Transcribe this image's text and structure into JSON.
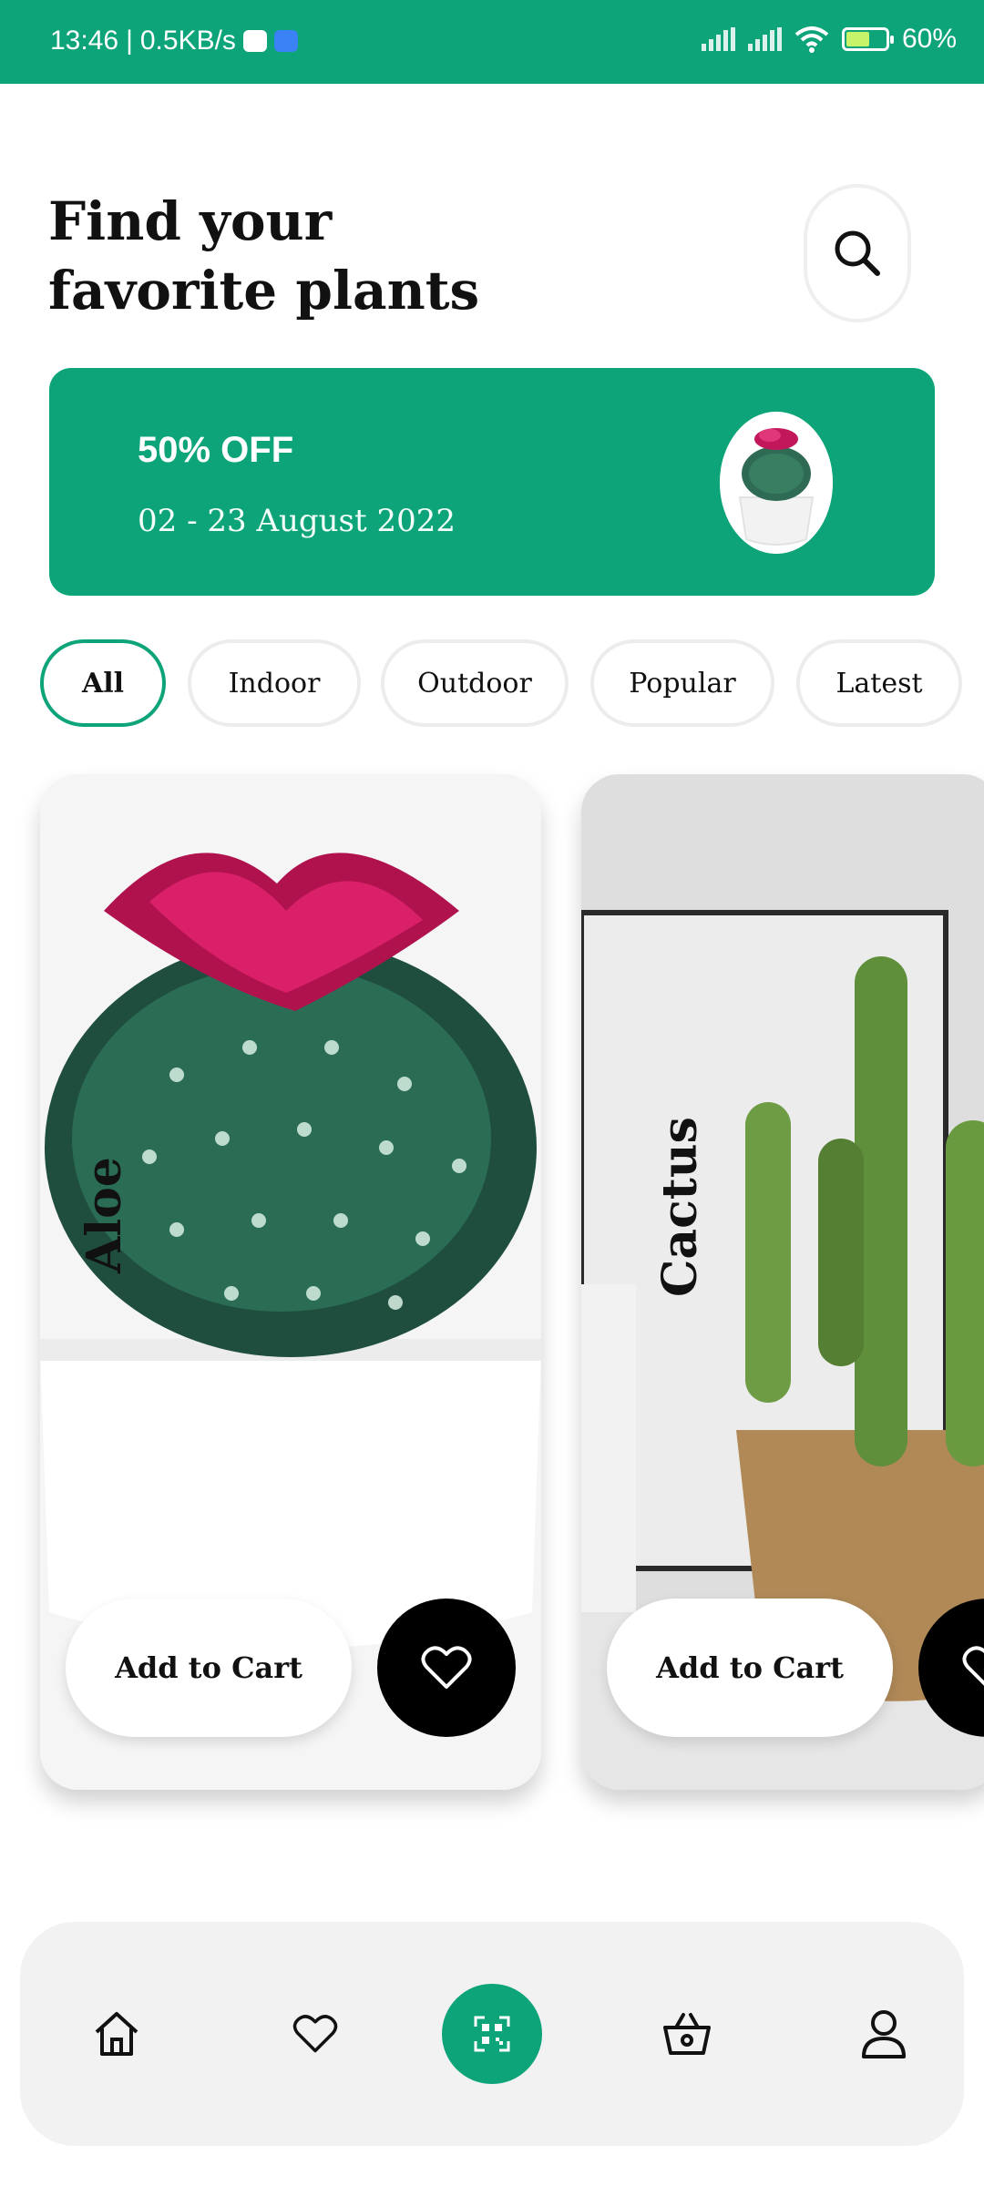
{
  "status_bar": {
    "time": "13:46",
    "separator": "|",
    "speed": "0.5KB/s",
    "battery": "60%",
    "battery_level": 0.6
  },
  "header": {
    "title": "Find your favorite plants",
    "search_icon": "search-icon"
  },
  "promo": {
    "discount": "50% OFF",
    "dates": "02 - 23 August 2022"
  },
  "categories": [
    {
      "label": "All",
      "active": true
    },
    {
      "label": "Indoor",
      "active": false
    },
    {
      "label": "Outdoor",
      "active": false
    },
    {
      "label": "Popular",
      "active": false
    },
    {
      "label": "Latest",
      "active": false
    }
  ],
  "products": [
    {
      "name": "Aloe",
      "cart_label": "Add to Cart",
      "fav_icon": "heart-icon"
    },
    {
      "name": "Cactus",
      "cart_label": "Add to Cart",
      "fav_icon": "heart-icon"
    }
  ],
  "bottom_nav": [
    {
      "icon": "home-icon"
    },
    {
      "icon": "heart-icon"
    },
    {
      "icon": "qr-code-icon"
    },
    {
      "icon": "basket-icon"
    },
    {
      "icon": "user-icon"
    }
  ],
  "colors": {
    "accent": "#0ea47a",
    "chip_border": "#ececec",
    "nav_bg": "#f2f2f2",
    "fav_button": "#000000"
  }
}
